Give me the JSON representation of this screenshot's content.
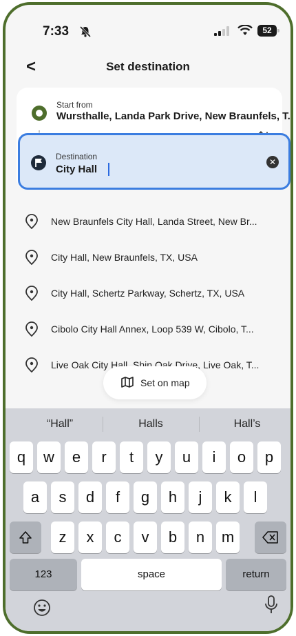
{
  "status": {
    "time": "7:33",
    "battery": "52"
  },
  "header": {
    "title": "Set destination",
    "back_label": "<"
  },
  "start": {
    "label": "Start from",
    "value": "Wursthalle, Landa Park Drive, New Braunfels, T..."
  },
  "destination": {
    "label": "Destination",
    "value": "City Hall"
  },
  "suggestions": [
    "New Braunfels City Hall, Landa Street, New Br...",
    "City Hall, New Braunfels, TX, USA",
    "City Hall, Schertz Parkway, Schertz, TX, USA",
    "Cibolo City Hall Annex, Loop 539 W, Cibolo, T...",
    "Live Oak City Hall, Shin Oak Drive, Live Oak, T..."
  ],
  "map_button": {
    "label": "Set on map"
  },
  "keyboard": {
    "predictions": [
      "“Hall”",
      "Halls",
      "Hall’s"
    ],
    "row1": [
      "q",
      "w",
      "e",
      "r",
      "t",
      "y",
      "u",
      "i",
      "o",
      "p"
    ],
    "row2": [
      "a",
      "s",
      "d",
      "f",
      "g",
      "h",
      "j",
      "k",
      "l"
    ],
    "row3": [
      "z",
      "x",
      "c",
      "v",
      "b",
      "n",
      "m"
    ],
    "numbers": "123",
    "space": "space",
    "return": "return"
  },
  "colors": {
    "accent": "#4e6e2c",
    "focus": "#3b7de0"
  }
}
